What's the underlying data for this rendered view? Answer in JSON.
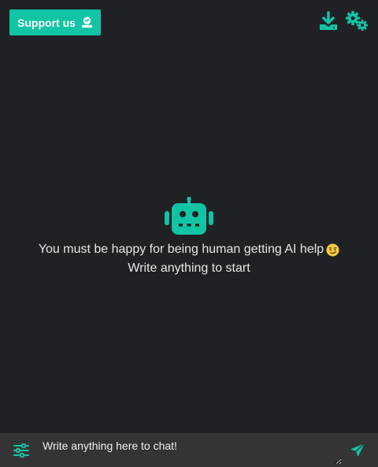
{
  "header": {
    "support_label": "Support us",
    "icons": [
      "hand-holding-heart-icon",
      "download-icon",
      "settings-gears-icon"
    ]
  },
  "empty_state": {
    "icon": "robot-icon",
    "line1": "You must be happy for being human getting AI help",
    "emoji": "smirk-face-emoji",
    "line2": "Write anything to start"
  },
  "chat": {
    "placeholder": "Write anything here to chat!",
    "value": "",
    "icons": [
      "sliders-icon",
      "send-icon"
    ]
  },
  "colors": {
    "accent": "#10c4a4",
    "background": "#202124",
    "input_bar": "#343434",
    "text": "#e6e6e6"
  }
}
